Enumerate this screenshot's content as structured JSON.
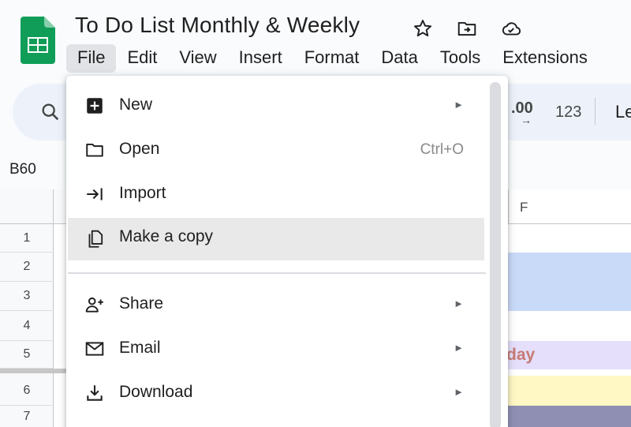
{
  "header": {
    "title": "To Do List Monthly & Weekly",
    "icons": [
      "star-icon",
      "move-to-folder-icon",
      "cloud-status-icon"
    ]
  },
  "menubar": {
    "items": [
      {
        "label": "File"
      },
      {
        "label": "Edit"
      },
      {
        "label": "View"
      },
      {
        "label": "Insert"
      },
      {
        "label": "Format"
      },
      {
        "label": "Data"
      },
      {
        "label": "Tools"
      },
      {
        "label": "Extensions"
      }
    ]
  },
  "toolbar": {
    "decimal_increase": ".00",
    "decimal_arrow": "→",
    "number_format": "123",
    "font_name": "Le"
  },
  "sheet": {
    "name_box": "B60",
    "column_f": "F",
    "rows": [
      "1",
      "2",
      "3",
      "4",
      "5",
      "6",
      "7"
    ],
    "partial_cell_text": "day"
  },
  "file_menu": {
    "items": [
      {
        "label": "New",
        "icon": "new-sheet-icon",
        "submenu": true
      },
      {
        "label": "Open",
        "icon": "folder-icon",
        "shortcut": "Ctrl+O"
      },
      {
        "label": "Import",
        "icon": "import-icon"
      },
      {
        "label": "Make a copy",
        "icon": "copy-icon",
        "highlighted": true
      },
      {
        "label": "Share",
        "icon": "share-person-icon",
        "submenu": true
      },
      {
        "label": "Email",
        "icon": "email-icon",
        "submenu": true
      },
      {
        "label": "Download",
        "icon": "download-icon",
        "submenu": true
      }
    ],
    "submenu_arrow": "►"
  },
  "colors": {
    "sheets_green": "#0f9d58",
    "menu_hover": "#e9e9e9",
    "toolbar_bg": "#edf2fa",
    "band_blue": "#c9daf8",
    "band_lavender": "#e5dffb",
    "band_yellow": "#fff8c4",
    "band_slate": "#8e8fb3",
    "day_text": "#c77a72"
  }
}
